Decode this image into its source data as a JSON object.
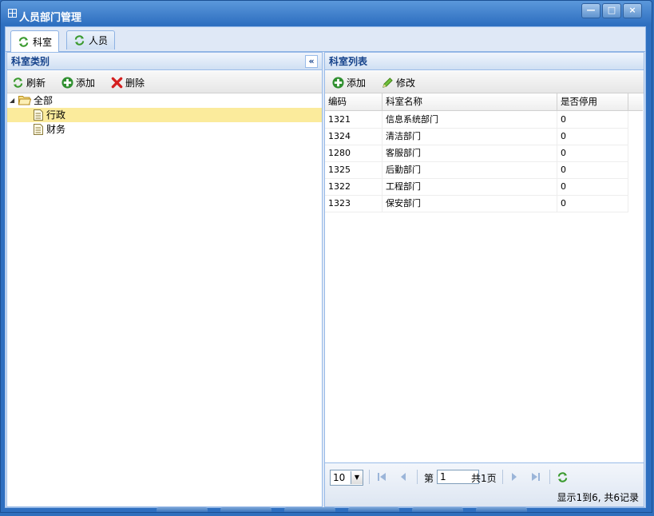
{
  "window": {
    "title": "人员部门管理",
    "controls": [
      "minimize-icon",
      "maximize-icon",
      "close-icon"
    ],
    "close_glyph": "×"
  },
  "tabs": [
    {
      "label": "科室",
      "icon": "refresh-icon",
      "active": true
    },
    {
      "label": "人员",
      "icon": "refresh-icon",
      "active": false
    }
  ],
  "left_panel": {
    "title": "科室类别",
    "collapse_glyph": "«",
    "toolbar": {
      "refresh": "刷新",
      "add": "添加",
      "delete": "删除"
    },
    "tree": [
      {
        "label": "全部",
        "icon": "folder-open-icon",
        "level": 0,
        "expanded": true,
        "selected": false
      },
      {
        "label": "行政",
        "icon": "document-icon",
        "level": 1,
        "selected": true
      },
      {
        "label": "财务",
        "icon": "document-icon",
        "level": 1,
        "selected": false
      }
    ]
  },
  "right_panel": {
    "title": "科室列表",
    "toolbar": {
      "add": "添加",
      "edit": "修改"
    },
    "columns": [
      "编码",
      "科室名称",
      "是否停用"
    ],
    "rows": [
      [
        "1321",
        "信息系统部门",
        "0"
      ],
      [
        "1324",
        "清洁部门",
        "0"
      ],
      [
        "1280",
        "客服部门",
        "0"
      ],
      [
        "1325",
        "后勤部门",
        "0"
      ],
      [
        "1322",
        "工程部门",
        "0"
      ],
      [
        "1323",
        "保安部门",
        "0"
      ]
    ],
    "pager": {
      "page_size": "10",
      "page_prefix": "第",
      "page_value": "1",
      "page_total": "共1页",
      "summary": "显示1到6, 共6记录"
    }
  },
  "colors": {
    "accent": "#15428b",
    "selected_row": "#fbeb9c",
    "window_blue": "#2e6fc0"
  }
}
